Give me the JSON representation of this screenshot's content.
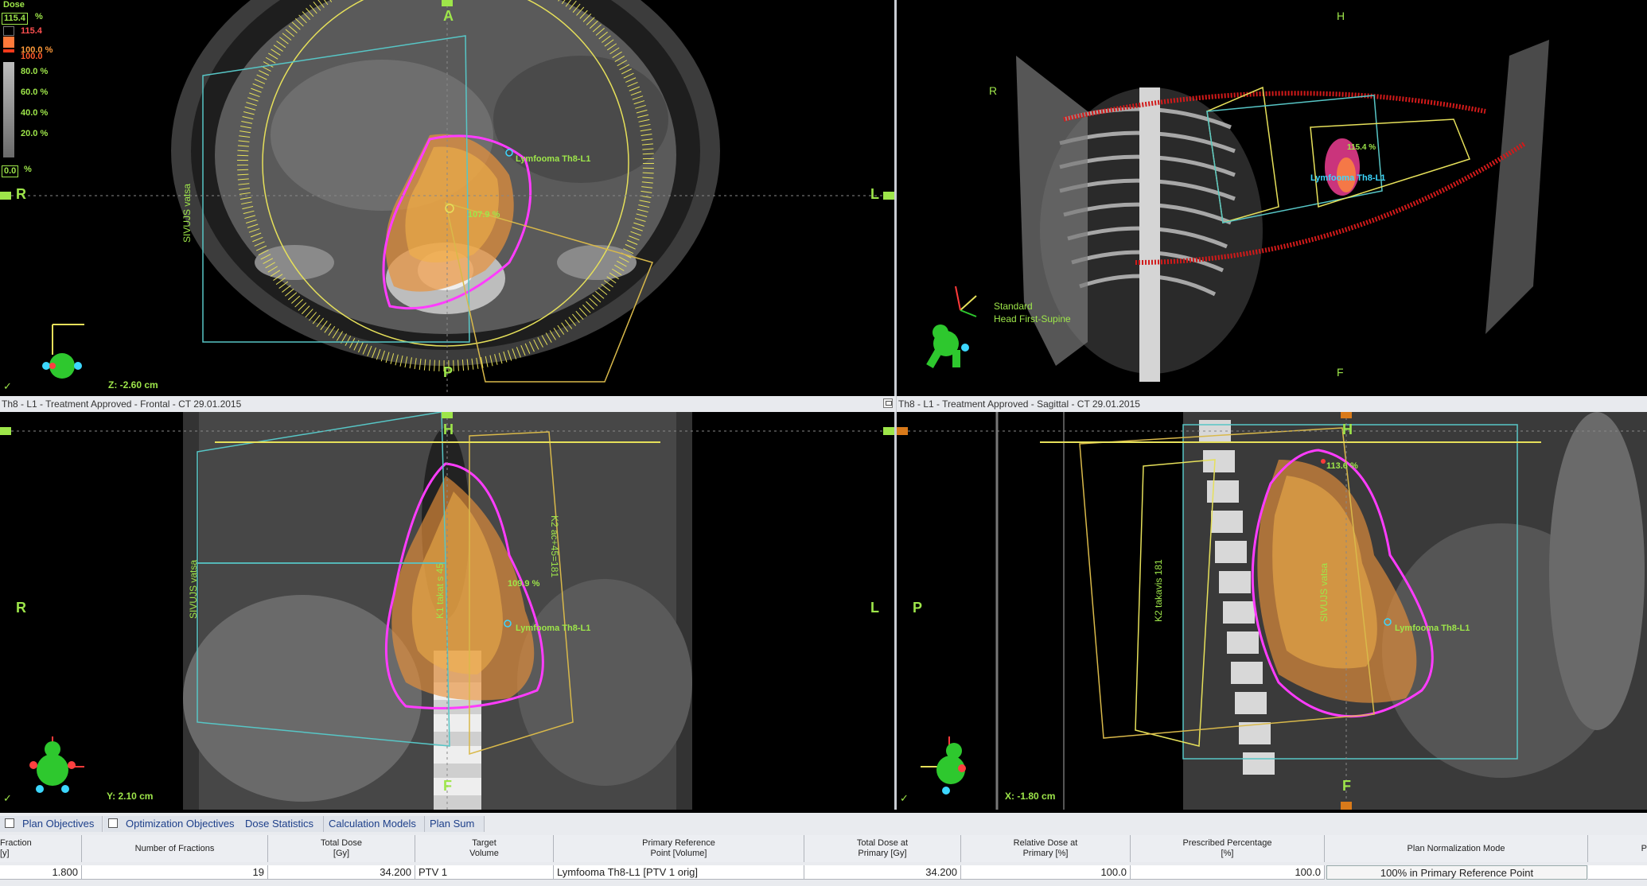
{
  "dose_legend": {
    "title": "Dose",
    "max_value": "115.4",
    "percent_symbol": "%",
    "max_label": "115.4",
    "labels": [
      "100.0 %",
      "100.0",
      "80.0 %",
      "60.0 %",
      "40.0 %",
      "20.0 %"
    ],
    "min_value": "0.0",
    "colors": {
      "max": "#ff7a3a",
      "mid": "#ff3a1a",
      "low": "#9a9a9a"
    }
  },
  "transverse": {
    "orient_top": "A",
    "orient_bottom": "P",
    "orient_left": "R",
    "orient_right": "L",
    "structure_label": "Lymfooma Th8-L1",
    "dose_point": "107.9 %",
    "field_label": "SIVUJS vatsa",
    "z_readout": "Z: -2.60 cm",
    "check": "✓"
  },
  "view3d": {
    "orient_top": "H",
    "orient_bottom": "F",
    "orient_left": "R",
    "orientation_line1": "Standard",
    "orientation_line2": "Head First-Supine",
    "structure_label": "Lymfooma Th8-L1",
    "dose_point": "115.4 %"
  },
  "frontal": {
    "title": "Th8 - L1  -  Treatment Approved - Frontal - CT 29.01.2015",
    "orient_top": "H",
    "orient_bottom": "F",
    "orient_left": "R",
    "orient_right": "L",
    "structure_label": "Lymfooma Th8-L1",
    "dose_point": "109.9 %",
    "field_label": "SIVUJS vatsa",
    "field_k1": "K1 takat s 45",
    "field_k2": "K2 ac+45=181",
    "y_readout": "Y: 2.10 cm",
    "check": "✓"
  },
  "sagittal": {
    "title": "Th8 - L1  -  Treatment Approved - Sagittal - CT 29.01.2015",
    "orient_top": "H",
    "orient_bottom": "F",
    "orient_left": "P",
    "structure_label": "Lymfooma Th8-L1",
    "dose_point": "113.6 %",
    "field_label": "SIVUJS vatsa",
    "field_k2": "K2 takavis 181",
    "x_readout": "X: -1.80 cm",
    "check": "✓"
  },
  "tabs": [
    {
      "label": "Plan Objectives",
      "checkbox": true
    },
    {
      "label": "Optimization Objectives",
      "checkbox": true
    },
    {
      "label": "Dose Statistics",
      "checkbox": false
    },
    {
      "label": "Calculation Models",
      "checkbox": false
    },
    {
      "label": "Plan Sum",
      "checkbox": false
    }
  ],
  "plan_table": {
    "headers": [
      "Fraction\n[y]",
      "Number of Fractions",
      "Total Dose\n[Gy]",
      "Target\nVolume",
      "Primary Reference\nPoint [Volume]",
      "Total Dose at\nPrimary [Gy]",
      "Relative Dose at\nPrimary [%]",
      "Prescribed Percentage\n[%]",
      "Plan Normalization Mode",
      "P"
    ],
    "row": [
      "1.800",
      "19",
      "34.200",
      "PTV 1",
      "Lymfooma Th8-L1 [PTV 1 orig]",
      "34.200",
      "100.0",
      "100.0",
      "100% in Primary Reference Point",
      ""
    ]
  }
}
